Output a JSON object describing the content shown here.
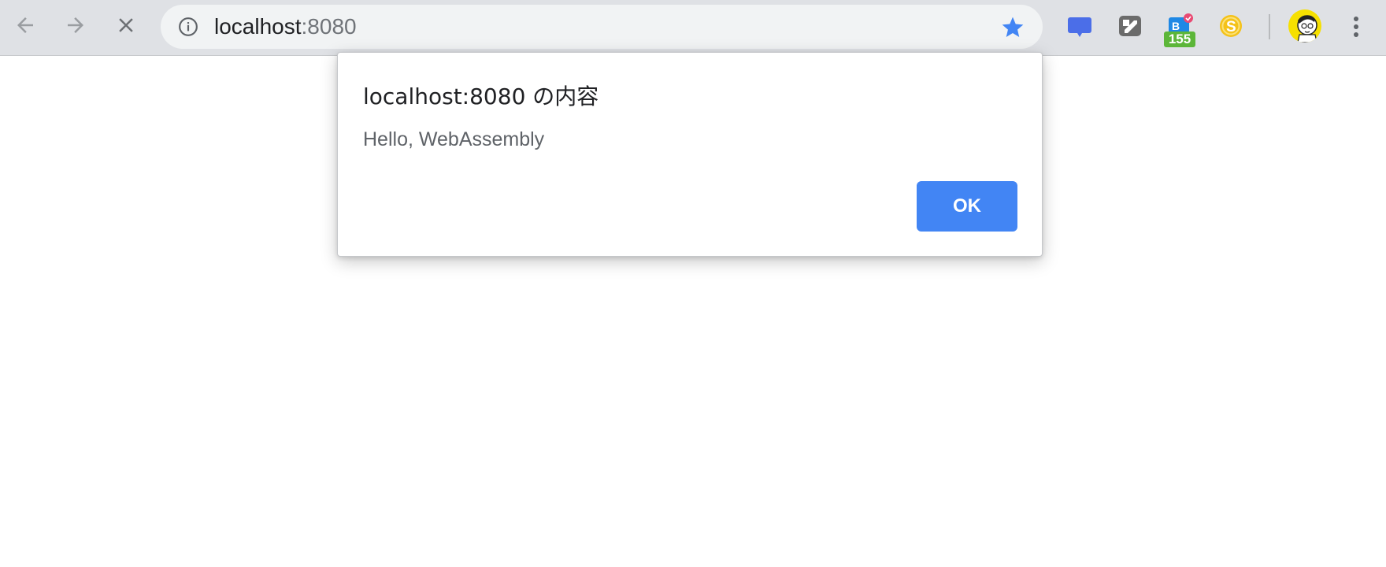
{
  "browser": {
    "nav": {
      "back_icon": "arrow-left-icon",
      "forward_icon": "arrow-right-icon",
      "stop_icon": "close-icon"
    },
    "omnibox": {
      "host": "localhost",
      "port": ":8080",
      "info_icon": "info-icon",
      "bookmark_icon": "star-icon",
      "bookmark_color": "#4285f4"
    },
    "extensions": [
      {
        "icon": "chat-bubble-icon",
        "color": "#4b6ee8"
      },
      {
        "icon": "app-logo-icon",
        "color": "#6b6b6b"
      },
      {
        "icon": "badge-extension-icon",
        "badge": "155",
        "badge_color": "#5cb639"
      },
      {
        "icon": "coin-icon",
        "color": "#f4c21a"
      }
    ],
    "avatar_icon": "user-avatar-icon",
    "menu_icon": "more-vert-icon"
  },
  "dialog": {
    "title": "localhost:8080 の内容",
    "message": "Hello, WebAssembly",
    "ok_label": "OK",
    "ok_color": "#4285f4"
  }
}
